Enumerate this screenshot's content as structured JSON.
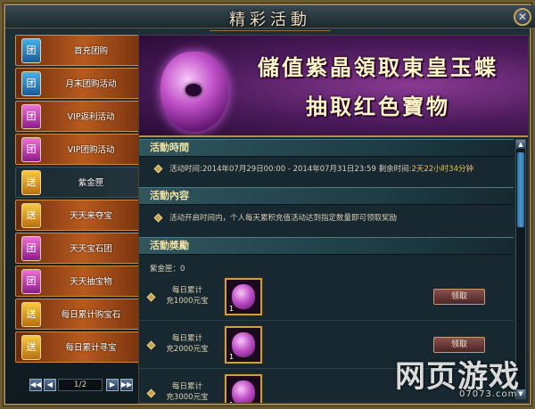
{
  "window": {
    "title": "精彩活動",
    "close_glyph": "✕"
  },
  "sidebar": {
    "items": [
      {
        "badge": "团",
        "badge_color": "blue",
        "label": "首充团购",
        "active": false
      },
      {
        "badge": "团",
        "badge_color": "blue",
        "label": "月末团购活动",
        "active": false
      },
      {
        "badge": "团",
        "badge_color": "pink",
        "label": "VIP返利活动",
        "active": false
      },
      {
        "badge": "团",
        "badge_color": "pink",
        "label": "VIP团购活动",
        "active": false
      },
      {
        "badge": "送",
        "badge_color": "gold",
        "label": "紫金匣",
        "active": true
      },
      {
        "badge": "送",
        "badge_color": "gold",
        "label": "天天来夺宝",
        "active": false
      },
      {
        "badge": "团",
        "badge_color": "pink",
        "label": "天天宝石团",
        "active": false
      },
      {
        "badge": "团",
        "badge_color": "pink",
        "label": "天天抽宝物",
        "active": false
      },
      {
        "badge": "送",
        "badge_color": "gold",
        "label": "每日累计购宝石",
        "active": false
      },
      {
        "badge": "送",
        "badge_color": "gold",
        "label": "每日累计寻宝",
        "active": false
      }
    ]
  },
  "pager": {
    "first": "◀◀",
    "prev": "◀",
    "page": "1/2",
    "next": "▶",
    "last": "▶▶"
  },
  "banner": {
    "line1": "儲值紫晶領取東皇玉蝶",
    "line2": "抽取红色寶物"
  },
  "sections": {
    "time": {
      "title": "活動時間",
      "label_start": "活动时间:",
      "range": "2014年07月29日00:00 - 2014年07月31日23:59",
      "label_remaining": "剩余时间:",
      "remaining": "2天22小时34分钟"
    },
    "content": {
      "title": "活動內容",
      "text": "活动开启时间内，个人每天累积充值活动达到指定数量即可领取奖励"
    },
    "rewards": {
      "title": "活動獎勵",
      "currency_label": "紫金匣：0",
      "rows": [
        {
          "line1": "每日累计",
          "line2": "充1000元宝",
          "count": "1",
          "button": "领取"
        },
        {
          "line1": "每日累计",
          "line2": "充2000元宝",
          "count": "1",
          "button": "领取"
        },
        {
          "line1": "每日累计",
          "line2": "充3000元宝",
          "count": "1",
          "button": ""
        }
      ]
    }
  },
  "scroll": {
    "up": "▲",
    "down": "▼"
  },
  "watermark": {
    "main": "网页游戏",
    "sub": "07073.com"
  }
}
